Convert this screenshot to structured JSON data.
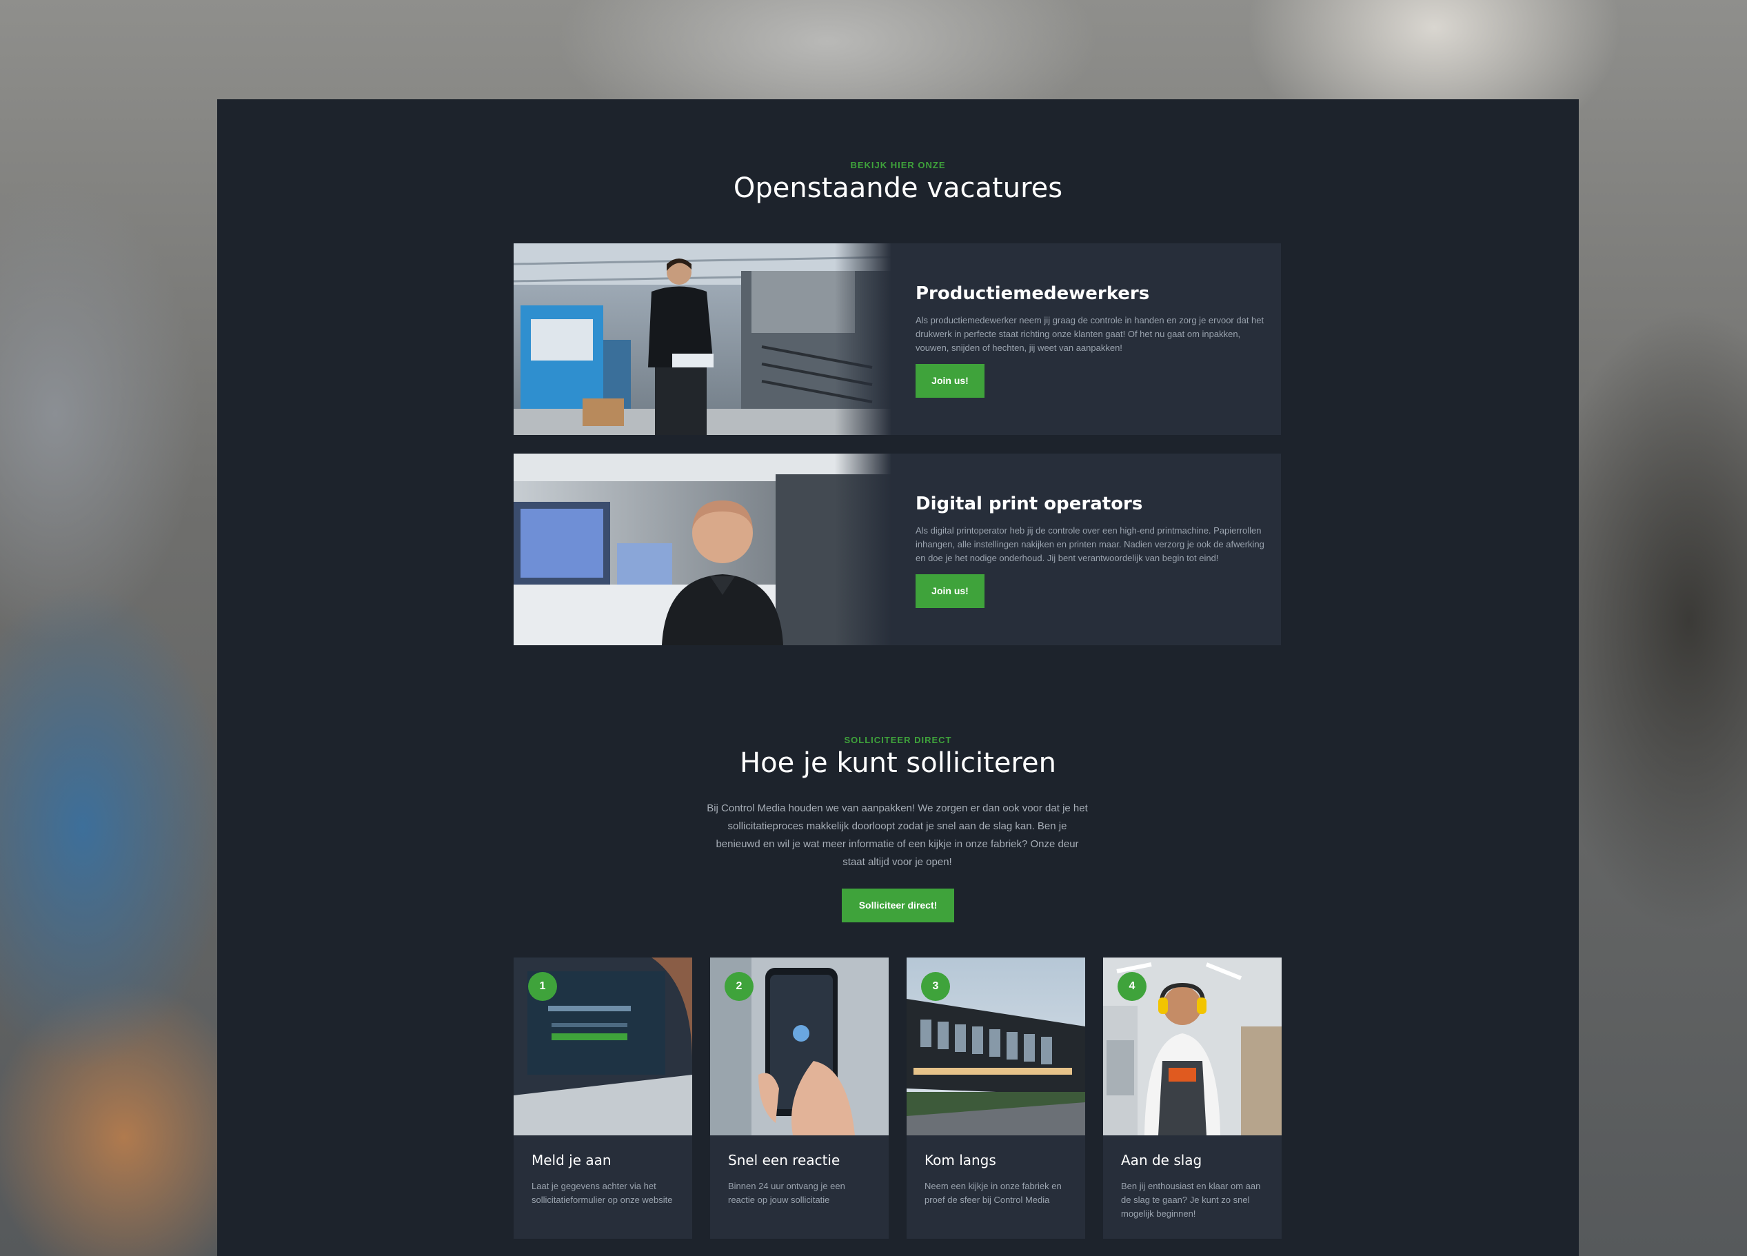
{
  "vacancies": {
    "eyebrow": "BEKIJK HIER ONZE",
    "title": "Openstaande vacatures",
    "jobs": [
      {
        "title": "Productiemedewerkers",
        "description": "Als productiemedewerker neem jij graag de controle in handen en zorg je ervoor dat het drukwerk in perfecte staat richting onze klanten gaat! Of het nu gaat om inpakken, vouwen, snijden of hechten, jij weet van aanpakken!",
        "button": "Join us!"
      },
      {
        "title": "Digital print operators",
        "description": "Als digital printoperator heb jij de controle over een high-end printmachine. Papierrollen inhangen, alle instellingen nakijken en printen maar. Nadien verzorg je ook de afwerking en doe je het nodige onderhoud. Jij bent verantwoordelijk van begin tot eind!",
        "button": "Join us!"
      }
    ]
  },
  "apply": {
    "eyebrow": "SOLLICITEER DIRECT",
    "title": "Hoe je kunt solliciteren",
    "intro": "Bij Control Media houden we van aanpakken! We zorgen er dan ook voor dat je het sollicitatieproces makkelijk doorloopt zodat je snel aan de slag kan. Ben je benieuwd en wil je wat meer informatie of een kijkje in onze fabriek? Onze deur staat altijd voor je open!",
    "button": "Solliciteer direct!",
    "steps": [
      {
        "number": "1",
        "title": "Meld je aan",
        "description": "Laat je gegevens achter via het sollicitatieformulier op onze website"
      },
      {
        "number": "2",
        "title": "Snel een reactie",
        "description": "Binnen 24 uur ontvang je een reactie op jouw sollicitatie"
      },
      {
        "number": "3",
        "title": "Kom langs",
        "description": "Neem een kijkje in onze fabriek en proef de sfeer bij Control Media"
      },
      {
        "number": "4",
        "title": "Aan de slag",
        "description": "Ben jij enthousiast en klaar om aan de slag te gaan? Je kunt zo snel mogelijk beginnen!"
      }
    ]
  },
  "colors": {
    "panel_bg": "#1d232c",
    "card_bg": "#272e3a",
    "accent_green": "#3fa33b",
    "heading_text": "#ffffff",
    "body_text": "#9aa3ae"
  }
}
